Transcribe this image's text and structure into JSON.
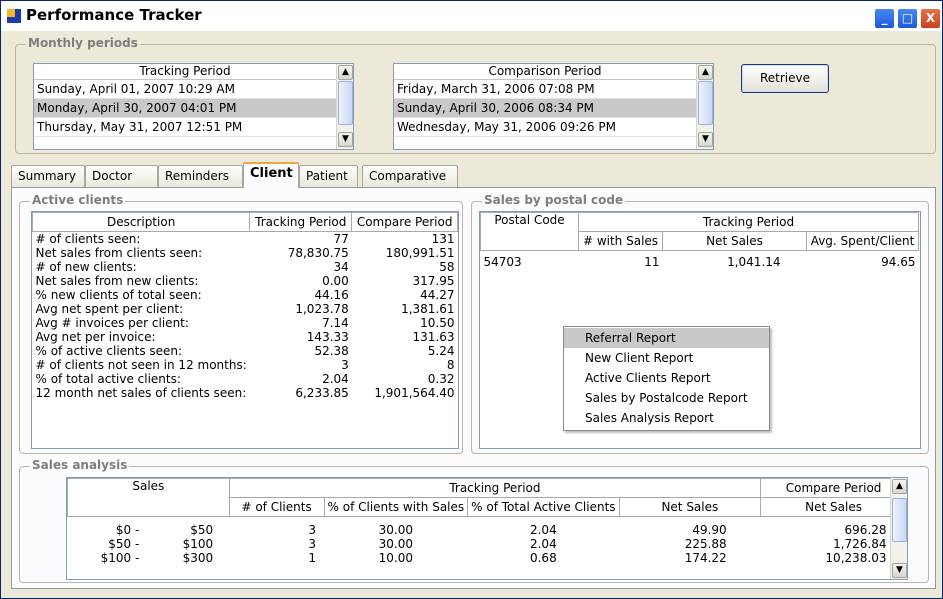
{
  "window": {
    "title": "Performance Tracker",
    "controls": {
      "minimize": "_",
      "maximize": "□",
      "close": "X"
    }
  },
  "monthly_periods": {
    "label": "Monthly periods",
    "tracking": {
      "header": "Tracking Period",
      "rows": [
        "Sunday, April 01, 2007 10:29 AM",
        "Monday, April 30, 2007 04:01 PM",
        "Thursday, May 31, 2007 12:51 PM"
      ]
    },
    "comparison": {
      "header": "Comparison Period",
      "rows": [
        "Friday, March 31, 2006 07:08 PM",
        "Sunday, April 30, 2006 08:34 PM",
        "Wednesday, May 31, 2006 09:26 PM"
      ]
    },
    "retrieve_label": "Retrieve"
  },
  "tabs": [
    "Summary",
    "Doctor",
    "Reminders",
    "Client",
    "Patient",
    "Comparative"
  ],
  "active_clients": {
    "label": "Active clients",
    "headers": [
      "Description",
      "Tracking Period",
      "Compare Period"
    ],
    "rows": [
      [
        "# of clients seen:",
        "77",
        "131"
      ],
      [
        "Net sales from clients seen:",
        "78,830.75",
        "180,991.51"
      ],
      [
        "# of new clients:",
        "34",
        "58"
      ],
      [
        "Net sales from new clients:",
        "0.00",
        "317.95"
      ],
      [
        "% new clients of total seen:",
        "44.16",
        "44.27"
      ],
      [
        "Avg net spent per client:",
        "1,023.78",
        "1,381.61"
      ],
      [
        "Avg # invoices per client:",
        "7.14",
        "10.50"
      ],
      [
        "Avg net per invoice:",
        "143.33",
        "131.63"
      ],
      [
        "% of active clients seen:",
        "52.38",
        "5.24"
      ],
      [
        "# of clients not seen in 12 months:",
        "3",
        "8"
      ],
      [
        "% of total active clients:",
        "2.04",
        "0.32"
      ],
      [
        "12 month net sales of clients seen:",
        "6,233.85",
        "1,901,564.40"
      ]
    ]
  },
  "sales_by_postal": {
    "label": "Sales by postal code",
    "header_postal": "Postal Code",
    "header_group": "Tracking Period",
    "subheaders": [
      "# with Sales",
      "Net Sales",
      "Avg. Spent/Client"
    ],
    "rows": [
      [
        "54703",
        "11",
        "1,041.14",
        "94.65"
      ]
    ]
  },
  "context_menu": {
    "items": [
      "Referral Report",
      "New Client Report",
      "Active Clients Report",
      "Sales by Postalcode Report",
      "Sales Analysis Report"
    ]
  },
  "sales_analysis": {
    "label": "Sales analysis",
    "header_sales": "Sales",
    "header_tracking": "Tracking Period",
    "header_compare": "Compare Period",
    "subheaders": [
      "# of Clients",
      "% of Clients with Sales",
      "% of Total Active Clients",
      "Net Sales",
      "Net Sales"
    ],
    "rows": [
      [
        "$0 -",
        "$50",
        "3",
        "30.00",
        "2.04",
        "49.90",
        "696.28"
      ],
      [
        "$50 -",
        "$100",
        "3",
        "30.00",
        "2.04",
        "225.88",
        "1,726.84"
      ],
      [
        "$100 -",
        "$300",
        "1",
        "10.00",
        "0.68",
        "174.22",
        "10,238.03"
      ]
    ]
  }
}
